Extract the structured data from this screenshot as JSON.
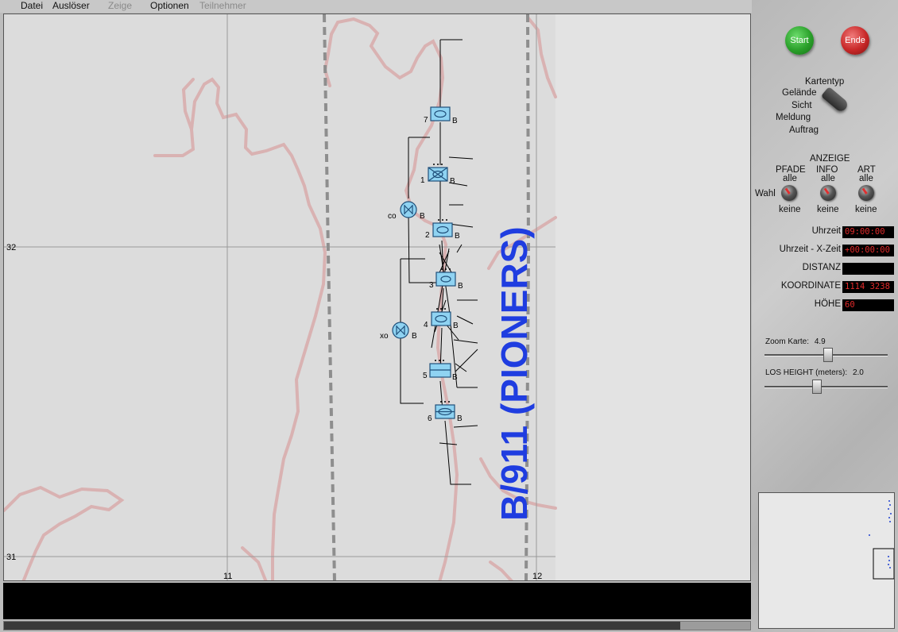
{
  "menu": {
    "items": [
      "Datei",
      "Auslöser",
      "Zeige",
      "Optionen",
      "Teilnehmer"
    ],
    "disabled": [
      false,
      false,
      true,
      false,
      true
    ]
  },
  "map": {
    "grid_labels": {
      "x_left": "11",
      "x_right": "12",
      "y_top": "32",
      "y_bottom": "31"
    },
    "unit_title": "B/911 (PIONERS)",
    "unit_title_color": "#1f3de0",
    "terrain_color": "#d9b2b2",
    "symbol_fill": "#8fd3f2",
    "units": [
      {
        "num": "7",
        "suffix": "B"
      },
      {
        "num": "1",
        "suffix": "B"
      },
      {
        "num": "2",
        "suffix": "B"
      },
      {
        "num": "3",
        "suffix": "B"
      },
      {
        "num": "4",
        "suffix": "B"
      },
      {
        "num": "5",
        "suffix": "B"
      },
      {
        "num": "6",
        "suffix": "B"
      }
    ],
    "hq": [
      {
        "num": "co",
        "suffix": "B"
      },
      {
        "num": "xo",
        "suffix": "B"
      }
    ]
  },
  "panel": {
    "start_label": "Start",
    "end_label": "Ende",
    "kartentyp": {
      "title": "Kartentyp",
      "options": [
        "Gelände",
        "Sicht",
        "Meldung",
        "Auftrag"
      ]
    },
    "anzeige": {
      "title": "ANZEIGE",
      "wahl": "Wahl",
      "columns": [
        {
          "title": "PFADE",
          "top": "alle",
          "bottom": "keine"
        },
        {
          "title": "INFO",
          "top": "alle",
          "bottom": "keine"
        },
        {
          "title": "ART",
          "top": "alle",
          "bottom": "keine"
        }
      ]
    },
    "readouts": [
      {
        "label": "Uhrzeit",
        "value": "09:00:00"
      },
      {
        "label": "Uhrzeit - X-Zeit",
        "value": "+00:00:00"
      },
      {
        "label": "DISTANZ",
        "value": ""
      },
      {
        "label": "KOORDINATE",
        "value": "1114 3238"
      },
      {
        "label": "HÖHE",
        "value": "60"
      }
    ],
    "zoom": {
      "label": "Zoom Karte:",
      "value": "4.9",
      "fraction": 0.52
    },
    "los": {
      "label": "LOS HEIGHT (meters):",
      "value": "2.0",
      "fraction": 0.42
    }
  },
  "colors": {
    "start": "#2aa02a",
    "end": "#c82828",
    "display_text": "#e02a2a"
  }
}
